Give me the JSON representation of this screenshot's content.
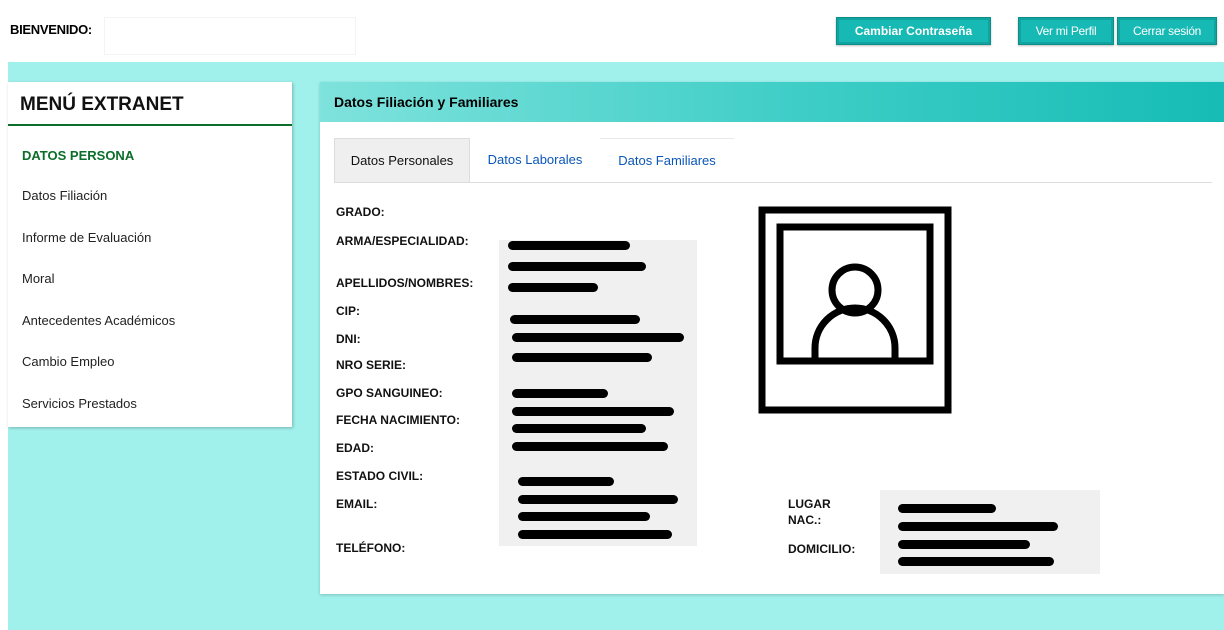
{
  "header": {
    "welcome_label": "BIENVENIDO:",
    "welcome_value": "",
    "buttons": {
      "change_password": "Cambiar Contraseña",
      "view_profile": "Ver mi Perfil",
      "logout": "Cerrar sesión"
    }
  },
  "sidebar": {
    "title": "MENÚ EXTRANET",
    "section": "DATOS PERSONA",
    "items": [
      {
        "label": "Datos Filiación"
      },
      {
        "label": "Informe de Evaluación"
      },
      {
        "label": "Moral"
      },
      {
        "label": "Antecedentes Académicos"
      },
      {
        "label": "Cambio Empleo"
      },
      {
        "label": "Servicios Prestados"
      }
    ]
  },
  "panel": {
    "title": "Datos Filiación y Familiares",
    "tabs": [
      {
        "label": "Datos Personales",
        "active": true
      },
      {
        "label": "Datos Laborales",
        "active": false
      },
      {
        "label": "Datos Familiares",
        "active": false
      }
    ],
    "fields": {
      "grado": "GRADO:",
      "arma": "ARMA/ESPECIALIDAD:",
      "apellidos": "APELLIDOS/NOMBRES:",
      "cip": "CIP:",
      "dni": "DNI:",
      "nro_serie": "NRO SERIE:",
      "gpo_sanguineo": "GPO SANGUINEO:",
      "fecha_nacimiento": "FECHA NACIMIENTO:",
      "edad": "EDAD:",
      "estado_civil": "ESTADO CIVIL:",
      "email": "EMAIL:",
      "telefono": "TELÉFONO:",
      "lugar_nac_line1": "LUGAR",
      "lugar_nac_line2": "NAC.:",
      "domicilio": "DOMICILIO:"
    },
    "photo_icon": "user-avatar-icon"
  },
  "colors": {
    "accent": "#16b9b4",
    "page_background": "#a0f0ec",
    "menu_green": "#0b6e2a",
    "tab_link": "#0a56b8"
  }
}
